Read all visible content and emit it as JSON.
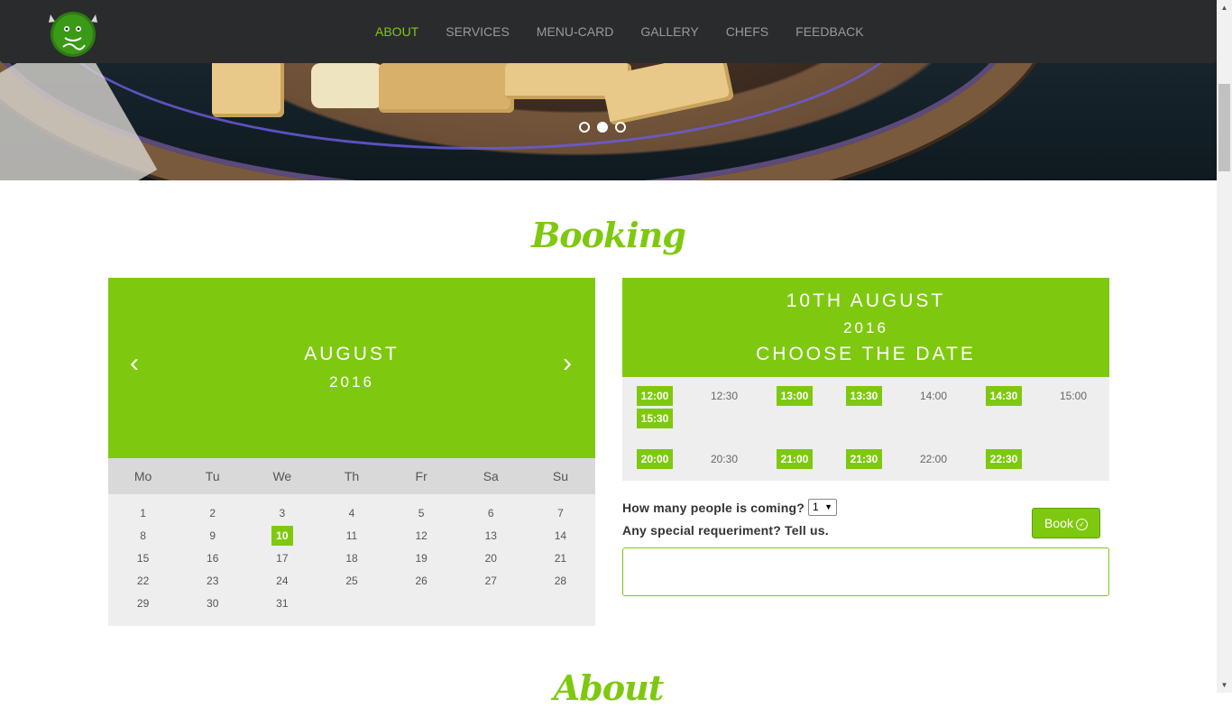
{
  "nav": {
    "items": [
      "ABOUT",
      "SERVICES",
      "MENU-CARD",
      "GALLERY",
      "CHEFS",
      "FEEDBACK"
    ],
    "active": "ABOUT"
  },
  "hero": {
    "slides": 3,
    "active_slide": 2
  },
  "booking": {
    "title": "Booking",
    "calendar": {
      "month": "AUGUST",
      "year": "2016",
      "prev": "‹",
      "next": "›",
      "weekdays": [
        "Mo",
        "Tu",
        "We",
        "Th",
        "Fr",
        "Sa",
        "Su"
      ],
      "days": [
        "1",
        "2",
        "3",
        "4",
        "5",
        "6",
        "7",
        "8",
        "9",
        "10",
        "11",
        "12",
        "13",
        "14",
        "15",
        "16",
        "17",
        "18",
        "19",
        "20",
        "21",
        "22",
        "23",
        "24",
        "25",
        "26",
        "27",
        "28",
        "29",
        "30",
        "31"
      ],
      "selected": "10"
    },
    "times": {
      "heading_line1": "10TH AUGUST",
      "heading_line2": "2016",
      "heading_line3": "CHOOSE THE DATE",
      "slots": [
        {
          "time": "12:00",
          "available": true
        },
        {
          "time": "12:30",
          "available": false
        },
        {
          "time": "13:00",
          "available": true
        },
        {
          "time": "13:30",
          "available": true
        },
        {
          "time": "14:00",
          "available": false
        },
        {
          "time": "14:30",
          "available": true
        },
        {
          "time": "15:00",
          "available": false
        },
        {
          "time": "15:30",
          "available": true
        },
        {
          "time": "20:00",
          "available": true
        },
        {
          "time": "20:30",
          "available": false
        },
        {
          "time": "21:00",
          "available": true
        },
        {
          "time": "21:30",
          "available": true
        },
        {
          "time": "22:00",
          "available": false
        },
        {
          "time": "22:30",
          "available": true
        }
      ]
    },
    "people_label": "How many people is coming?",
    "people_value": "1",
    "requirement_label": "Any special requeriment?  Tell us.",
    "book_label": "Book"
  },
  "about": {
    "title": "About"
  },
  "colors": {
    "accent": "#7ec90f",
    "navbar": "#2a2b2d"
  }
}
